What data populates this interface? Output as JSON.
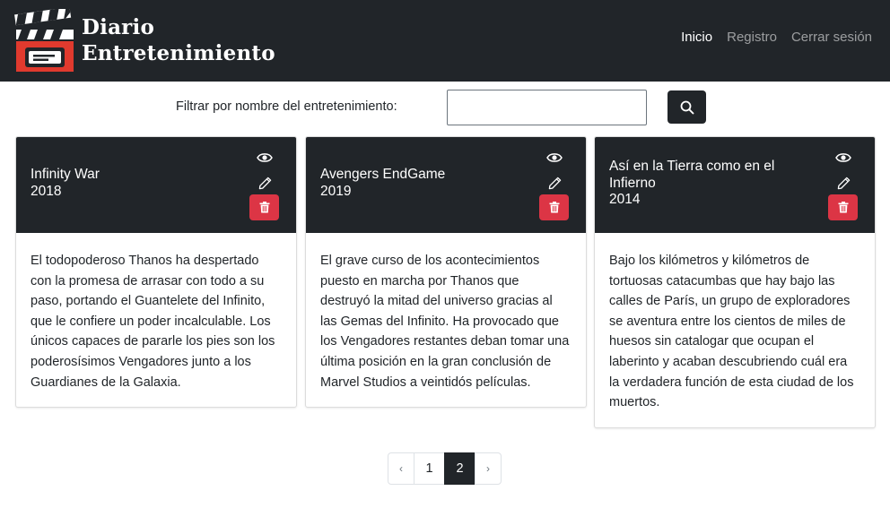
{
  "navbar": {
    "brand_line1": "Diario",
    "brand_line2": "Entretenimiento",
    "links": [
      {
        "label": "Inicio",
        "active": true
      },
      {
        "label": "Registro",
        "active": false
      },
      {
        "label": "Cerrar sesión",
        "active": false
      }
    ]
  },
  "filter": {
    "label": "Filtrar por nombre del entretenimiento:",
    "value": "",
    "search_icon": "search-icon"
  },
  "cards": [
    {
      "title": "Infinity War",
      "year": "2018",
      "description": "El todopoderoso Thanos ha despertado con la promesa de arrasar con todo a su paso, portando el Guantelete del Infinito, que le confiere un poder incalculable. Los únicos capaces de pararle los pies son los poderosísimos Vengadores junto a los Guardianes de la Galaxia."
    },
    {
      "title": "Avengers EndGame",
      "year": "2019",
      "description": "El grave curso de los acontecimientos puesto en marcha por Thanos que destruyó la mitad del universo gracias al las Gemas del Infinito. Ha provocado que los Vengadores restantes deban tomar una última posición en la gran conclusión de Marvel Studios a veintidós películas."
    },
    {
      "title": "Así en la Tierra como en el Infierno",
      "year": "2014",
      "description": "Bajo los kilómetros y kilómetros de tortuosas catacumbas que hay bajo las calles de París, un grupo de exploradores se aventura entre los cientos de miles de huesos sin catalogar que ocupan el laberinto y acaban descubriendo cuál era la verdadera función de esta ciudad de los muertos."
    }
  ],
  "pagination": {
    "prev": "‹",
    "pages": [
      "1",
      "2"
    ],
    "active_page": "2",
    "next": "›"
  },
  "colors": {
    "navbar_bg": "#212529",
    "delete_button": "#dc3545",
    "logo_red": "#e03a2e"
  }
}
